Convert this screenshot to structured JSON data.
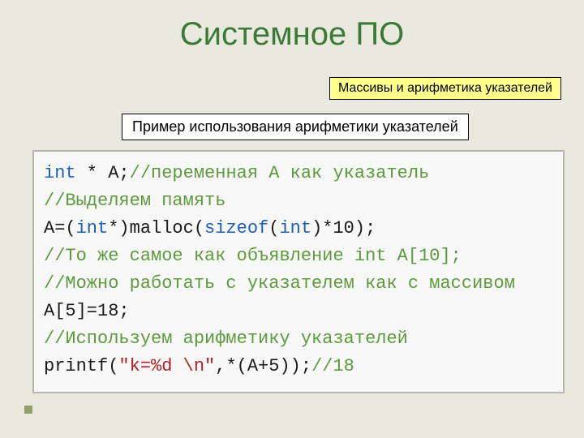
{
  "title": "Системное ПО",
  "tag": "Массивы и арифметика указателей",
  "subtitle": "Пример использования арифметики указателей",
  "code": {
    "l1_kw": "int",
    "l1_txt": " * A;",
    "l1_cmt": "//переменная А как указатель",
    "l2_cmt": "//Выделяем память",
    "l3a": "A=(",
    "l3_kw1": "int",
    "l3b": "*)malloc(",
    "l3_kw2": "sizeof",
    "l3c": "(",
    "l3_kw3": "int",
    "l3d": ")*10);",
    "l4_cmt": "//То же самое как объявление int A[10];",
    "l5_cmt": "//Можно работать с указателем как с массивом",
    "l6": "A[5]=18;",
    "l7_cmt": "//Используем арифметику указателей",
    "l8a": "printf(",
    "l8_str": "\"k=%d \\n\"",
    "l8b": ",*(A+5));",
    "l8_cmt": "//18"
  }
}
